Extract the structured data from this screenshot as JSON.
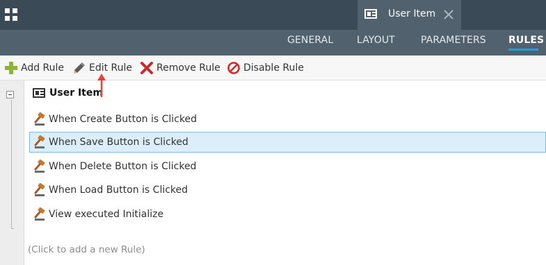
{
  "tab": {
    "title": "User Item"
  },
  "nav": {
    "tabs": [
      {
        "label": "GENERAL"
      },
      {
        "label": "LAYOUT"
      },
      {
        "label": "PARAMETERS"
      },
      {
        "label": "RULES"
      }
    ],
    "active": "RULES"
  },
  "toolbar": {
    "add_label": "Add Rule",
    "edit_label": "Edit Rule",
    "remove_label": "Remove Rule",
    "disable_label": "Disable Rule"
  },
  "rules_panel": {
    "title": "User Item",
    "rules": [
      {
        "label": "When Create Button is Clicked"
      },
      {
        "label": "When Save Button is Clicked",
        "selected": true
      },
      {
        "label": "When Delete Button is Clicked"
      },
      {
        "label": "When Load Button is Clicked"
      },
      {
        "label": "View executed Initialize"
      }
    ],
    "add_hint": "(Click to add a new Rule)"
  },
  "colors": {
    "topbar": "#3a4a56",
    "navbar": "#51616d",
    "accent": "#1aa1e8",
    "selection": "#ddeefb",
    "annotation": "#e8413c"
  },
  "icons": {
    "app": "grid-icon",
    "tab": "view-icon",
    "close": "close-icon",
    "add": "plus-icon",
    "edit": "pencil-icon",
    "remove": "x-icon",
    "disable": "no-entry-icon",
    "rule": "gavel-icon"
  }
}
